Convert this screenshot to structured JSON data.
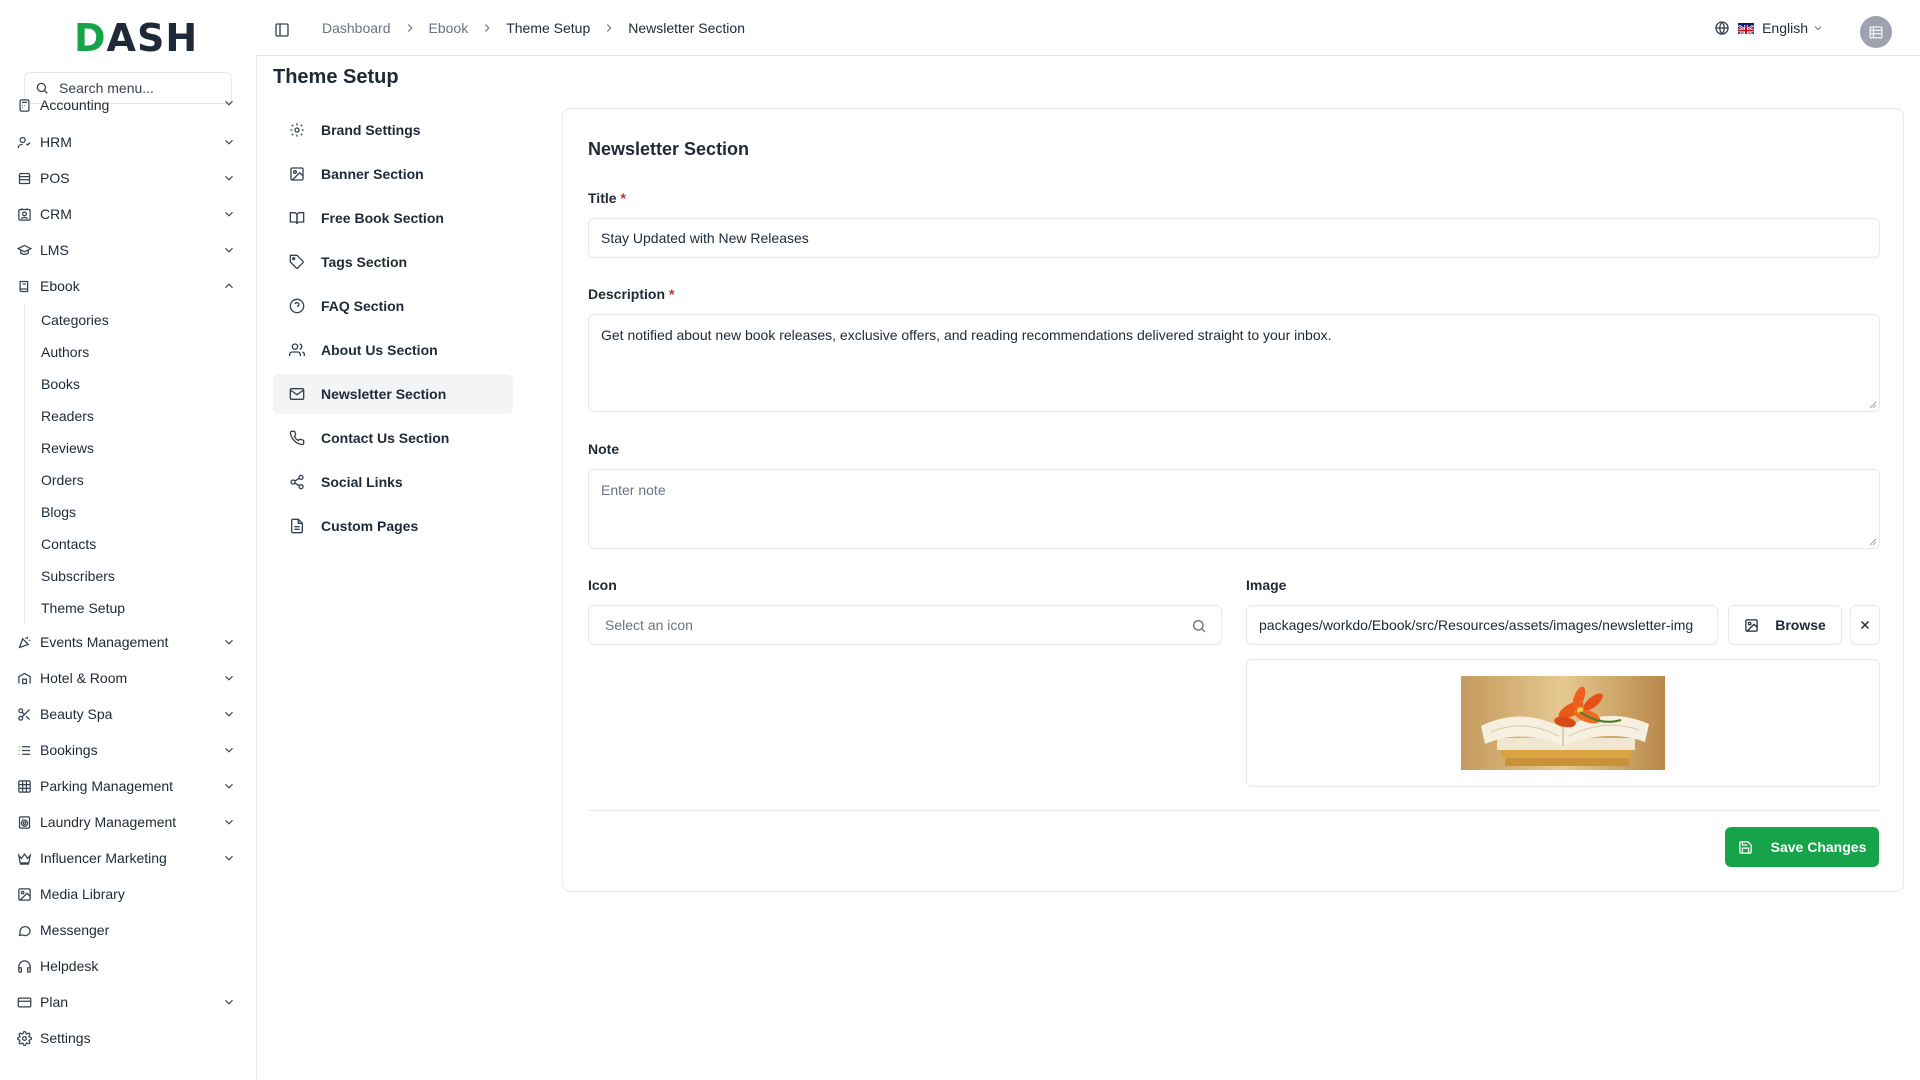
{
  "brand": {
    "logo_text_left": "D",
    "logo_text_right": "ASH",
    "accent": "#16a34a"
  },
  "sidebar": {
    "search_placeholder": "Search menu...",
    "items": [
      {
        "label": "Accounting",
        "icon": "calculator-icon",
        "chevron": true
      },
      {
        "label": "HRM",
        "icon": "users-icon",
        "chevron": true
      },
      {
        "label": "POS",
        "icon": "store-icon",
        "chevron": true
      },
      {
        "label": "CRM",
        "icon": "contact-icon",
        "chevron": true
      },
      {
        "label": "LMS",
        "icon": "graduation-cap-icon",
        "chevron": true
      },
      {
        "label": "Ebook",
        "icon": "book-icon",
        "chevron": true,
        "expanded": true
      }
    ],
    "ebook_children": [
      "Categories",
      "Authors",
      "Books",
      "Readers",
      "Reviews",
      "Orders",
      "Blogs",
      "Contacts",
      "Subscribers",
      "Theme Setup"
    ],
    "items_after": [
      {
        "label": "Events Management",
        "icon": "party-icon",
        "chevron": true
      },
      {
        "label": "Hotel & Room",
        "icon": "hotel-icon",
        "chevron": true
      },
      {
        "label": "Beauty Spa",
        "icon": "scissors-icon",
        "chevron": true
      },
      {
        "label": "Bookings",
        "icon": "list-icon",
        "chevron": true
      },
      {
        "label": "Parking Management",
        "icon": "grid-icon",
        "chevron": true
      },
      {
        "label": "Laundry Management",
        "icon": "washing-machine-icon",
        "chevron": true
      },
      {
        "label": "Influencer Marketing",
        "icon": "crown-icon",
        "chevron": true
      },
      {
        "label": "Media Library",
        "icon": "image-icon",
        "chevron": false
      },
      {
        "label": "Messenger",
        "icon": "message-icon",
        "chevron": false
      },
      {
        "label": "Helpdesk",
        "icon": "headphones-icon",
        "chevron": false
      },
      {
        "label": "Plan",
        "icon": "credit-card-icon",
        "chevron": true
      },
      {
        "label": "Settings",
        "icon": "gear-icon",
        "chevron": false
      }
    ]
  },
  "topbar": {
    "breadcrumbs": [
      "Dashboard",
      "Ebook",
      "Theme Setup",
      "Newsletter Section"
    ],
    "language": "English"
  },
  "page": {
    "title": "Theme Setup",
    "setup_menu": [
      {
        "label": "Brand Settings",
        "icon": "gear-icon"
      },
      {
        "label": "Banner Section",
        "icon": "image-icon"
      },
      {
        "label": "Free Book Section",
        "icon": "open-book-icon"
      },
      {
        "label": "Tags Section",
        "icon": "tag-icon"
      },
      {
        "label": "FAQ Section",
        "icon": "help-circle-icon"
      },
      {
        "label": "About Us Section",
        "icon": "users-icon"
      },
      {
        "label": "Newsletter Section",
        "icon": "mail-icon",
        "active": true
      },
      {
        "label": "Contact Us Section",
        "icon": "phone-icon"
      },
      {
        "label": "Social Links",
        "icon": "share-icon"
      },
      {
        "label": "Custom Pages",
        "icon": "file-text-icon"
      }
    ]
  },
  "form": {
    "heading": "Newsletter Section",
    "title_label": "Title",
    "title_value": "Stay Updated with New Releases",
    "description_label": "Description",
    "description_value": "Get notified about new book releases, exclusive offers, and reading recommendations delivered straight to your inbox.",
    "note_label": "Note",
    "note_placeholder": "Enter note",
    "icon_label": "Icon",
    "icon_placeholder": "Select an icon",
    "image_label": "Image",
    "image_value": "packages/workdo/Ebook/src/Resources/assets/images/newsletter-img",
    "browse_label": "Browse",
    "save_label": "Save Changes",
    "required_mark": "*"
  }
}
